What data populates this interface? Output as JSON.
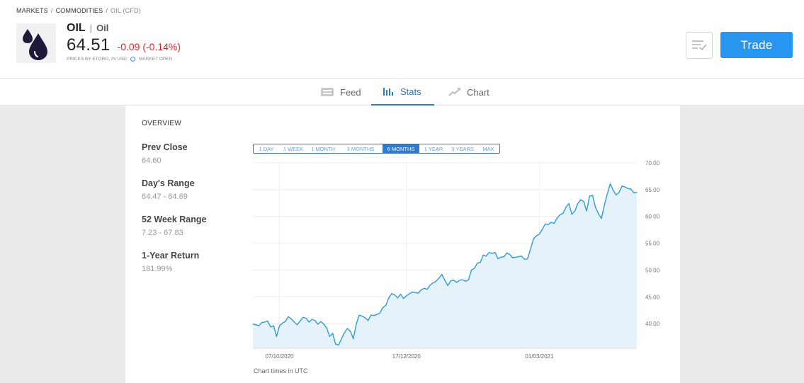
{
  "breadcrumb": {
    "markets": "MARKETS",
    "commodities": "COMMODITIES",
    "current": "OIL (CFD)"
  },
  "instrument": {
    "symbol": "OIL",
    "name": "Oil",
    "price": "64.51",
    "change": "-0.09 (-0.14%)",
    "price_note": "PRICES BY ETORO, IN USD",
    "market_status": "MARKET OPEN",
    "logo_icon": "oil-drops-icon"
  },
  "actions": {
    "trade_label": "Trade",
    "watchlist_icon": "watchlist-icon"
  },
  "tabs": [
    {
      "label": "Feed",
      "icon": "feed-icon"
    },
    {
      "label": "Stats",
      "icon": "bar-chart-icon"
    },
    {
      "label": "Chart",
      "icon": "trend-chart-icon"
    }
  ],
  "colors": {
    "accent": "#2895f1",
    "negative": "#e0272a",
    "line": "#2e9bd6",
    "area": "#e6f2fa"
  },
  "overview": {
    "title": "OVERVIEW",
    "stats": [
      {
        "label": "Prev Close",
        "value": "64.60"
      },
      {
        "label": "Day's Range",
        "value": "64.47 - 64.69"
      },
      {
        "label": "52 Week Range",
        "value": "7.23 - 67.83"
      },
      {
        "label": "1-Year Return",
        "value": "181.99%"
      }
    ]
  },
  "ranges": [
    "1 DAY",
    "1 WEEK",
    "1 MONTH",
    "3 MONTHS",
    "6 MONTHS",
    "1 YEAR",
    "3 YEARS",
    "MAX"
  ],
  "selected_range": "6 MONTHS",
  "chart_note": "Chart times in UTC",
  "chart_data": {
    "type": "area",
    "y_axis_position": "right",
    "ylim": [
      35.4,
      70
    ],
    "yticks": [
      "70.00",
      "65.00",
      "60.00",
      "55.00",
      "50.00",
      "45.00",
      "40.00"
    ],
    "ytick_values": [
      70,
      65,
      60,
      55,
      50,
      45,
      40
    ],
    "xtick_labels": [
      "07/10/2020",
      "17/12/2020",
      "01/03/2021"
    ],
    "xtick_index": [
      9,
      52,
      97
    ],
    "grid": true,
    "values": [
      39.9,
      39.8,
      39.6,
      40.2,
      40.3,
      40.5,
      39.4,
      39.6,
      37.6,
      39.6,
      40.1,
      40.4,
      41.3,
      40.9,
      40.3,
      39.8,
      40.5,
      41.2,
      41.0,
      40.3,
      40.8,
      40.6,
      39.9,
      40.4,
      39.9,
      39.2,
      37.6,
      38.2,
      36.2,
      36.0,
      37.2,
      38.3,
      39.1,
      38.6,
      37.2,
      39.9,
      41.6,
      41.4,
      41.1,
      40.6,
      41.6,
      41.5,
      41.7,
      42.0,
      43.0,
      43.4,
      44.8,
      45.6,
      45.4,
      44.8,
      45.5,
      44.7,
      45.2,
      45.6,
      45.9,
      45.8,
      45.7,
      46.3,
      46.6,
      46.4,
      47.2,
      47.6,
      47.9,
      48.5,
      49.2,
      48.1,
      47.1,
      48.0,
      48.1,
      47.7,
      48.1,
      48.2,
      47.9,
      48.2,
      50.0,
      50.3,
      51.3,
      51.4,
      52.8,
      52.6,
      53.3,
      53.1,
      53.3,
      52.1,
      52.4,
      52.5,
      53.2,
      52.9,
      52.3,
      52.4,
      52.5,
      52.6,
      52.0,
      52.1,
      53.9,
      55.8,
      56.4,
      56.7,
      57.6,
      58.6,
      58.5,
      58.9,
      58.7,
      59.7,
      60.3,
      60.6,
      61.7,
      62.4,
      60.4,
      61.0,
      62.4,
      63.1,
      62.8,
      61.0,
      63.8,
      63.9,
      61.7,
      60.5,
      59.6,
      62.1,
      64.2,
      66.1,
      64.9,
      64.0,
      64.5,
      65.7,
      65.5,
      65.2,
      65.1,
      64.4,
      64.51
    ]
  }
}
